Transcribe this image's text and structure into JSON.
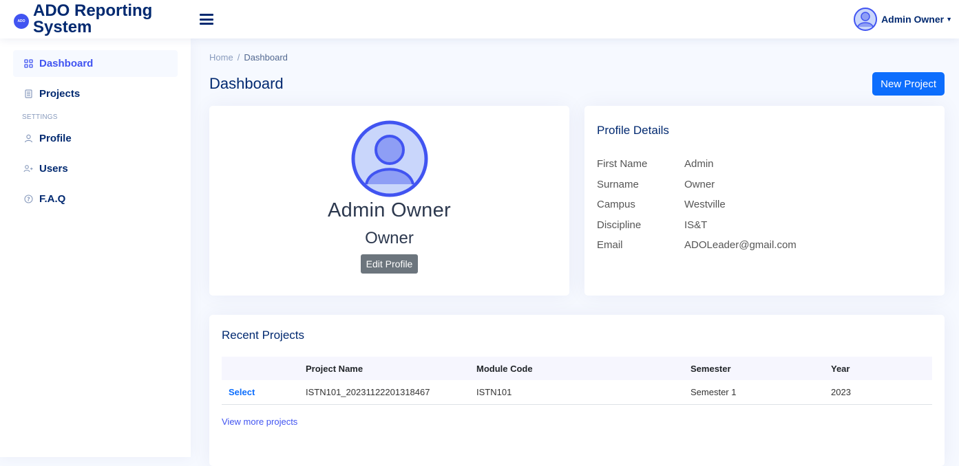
{
  "header": {
    "logo_badge": "ADO",
    "logo_line1": "ADO Reporting",
    "logo_line2": "System",
    "user_name": "Admin Owner",
    "colors": {
      "accent": "#4154f1",
      "navy": "#012970",
      "primary_button": "#0d6efd"
    },
    "icons": [
      "logo-icon",
      "hamburger-menu-icon",
      "user-avatar-icon",
      "caret-down-icon"
    ]
  },
  "sidebar": {
    "items": [
      {
        "label": "Dashboard",
        "icon": "grid-icon",
        "active": true
      },
      {
        "label": "Projects",
        "icon": "journal-icon",
        "active": false
      }
    ],
    "settings_heading": "SETTINGS",
    "settings_items": [
      {
        "label": "Profile",
        "icon": "person-icon"
      },
      {
        "label": "Users",
        "icon": "person-plus-icon"
      },
      {
        "label": "F.A.Q",
        "icon": "question-circle-icon"
      }
    ]
  },
  "breadcrumb": {
    "home": "Home",
    "separator": "/",
    "current": "Dashboard"
  },
  "page": {
    "title": "Dashboard",
    "new_project_label": "New Project"
  },
  "profile_card": {
    "name": "Admin Owner",
    "role": "Owner",
    "edit_label": "Edit Profile"
  },
  "profile_details": {
    "title": "Profile Details",
    "rows": [
      {
        "label": "First Name",
        "value": "Admin"
      },
      {
        "label": "Surname",
        "value": "Owner"
      },
      {
        "label": "Campus",
        "value": "Westville"
      },
      {
        "label": "Discipline",
        "value": "IS&T"
      },
      {
        "label": "Email",
        "value": "ADOLeader@gmail.com"
      }
    ]
  },
  "recent_projects": {
    "title": "Recent Projects",
    "columns": [
      "",
      "Project Name",
      "Module Code",
      "Semester",
      "Year"
    ],
    "rows": [
      {
        "action": "Select",
        "project_name": "ISTN101_20231122201318467",
        "module_code": "ISTN101",
        "semester": "Semester 1",
        "year": "2023"
      }
    ],
    "view_more": "View more projects"
  }
}
